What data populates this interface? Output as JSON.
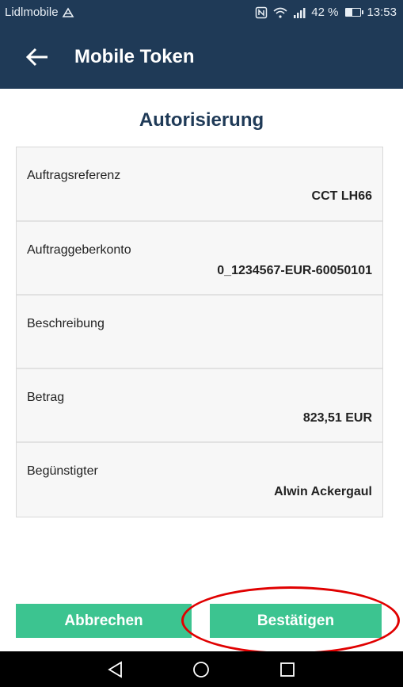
{
  "status_bar": {
    "carrier": "Lidlmobile",
    "battery": "42 %",
    "battery_level": 0.42,
    "time": "13:53"
  },
  "app_bar": {
    "title": "Mobile Token"
  },
  "heading": "Autorisierung",
  "details": [
    {
      "label": "Auftragsreferenz",
      "value": "CCT LH66"
    },
    {
      "label": "Auftraggeberkonto",
      "value": "0_1234567-EUR-60050101"
    },
    {
      "label": "Beschreibung",
      "value": ""
    },
    {
      "label": "Betrag",
      "value": "823,51 EUR"
    },
    {
      "label": "Begünstigter",
      "value": "Alwin Ackergaul"
    }
  ],
  "actions": {
    "cancel_label": "Abbrechen",
    "confirm_label": "Bestätigen"
  },
  "colors": {
    "header": "#1f3a57",
    "button": "#3cc490",
    "highlight": "#e00000"
  }
}
